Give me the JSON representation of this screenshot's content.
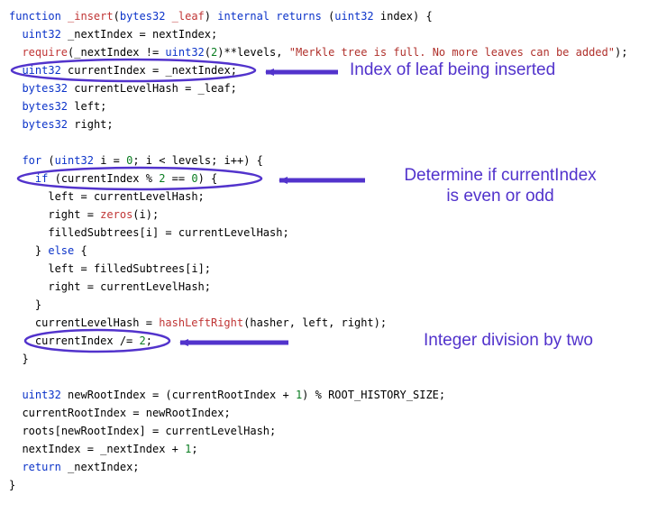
{
  "code": {
    "l1": {
      "a": "function",
      "b": "_insert",
      "c": "bytes32",
      "d": "_leaf",
      "e": "internal",
      "f": "returns",
      "g": "uint32",
      "h": "index"
    },
    "l2": {
      "a": "uint32",
      "b": "_nextIndex",
      "c": "nextIndex"
    },
    "l3": {
      "a": "require",
      "b": "_nextIndex",
      "c": "uint32",
      "d": "2",
      "e": "levels",
      "f": "\"Merkle tree is full. No more leaves can be added\""
    },
    "l4": {
      "a": "uint32",
      "b": "currentIndex",
      "c": "_nextIndex"
    },
    "l5": {
      "a": "bytes32",
      "b": "currentLevelHash",
      "c": "_leaf"
    },
    "l6": {
      "a": "bytes32",
      "b": "left"
    },
    "l7": {
      "a": "bytes32",
      "b": "right"
    },
    "l8": {
      "a": "for",
      "b": "uint32",
      "c": "i",
      "d": "0",
      "e": "i",
      "f": "levels",
      "g": "i"
    },
    "l9": {
      "a": "if",
      "b": "currentIndex",
      "c": "2",
      "d": "0"
    },
    "l10": {
      "a": "left",
      "b": "currentLevelHash"
    },
    "l11": {
      "a": "right",
      "b": "zeros",
      "c": "i"
    },
    "l12": {
      "a": "filledSubtrees",
      "b": "i",
      "c": "currentLevelHash"
    },
    "l13": {
      "a": "else"
    },
    "l14": {
      "a": "left",
      "b": "filledSubtrees",
      "c": "i"
    },
    "l15": {
      "a": "right",
      "b": "currentLevelHash"
    },
    "l16": {
      "a": "currentLevelHash",
      "b": "hashLeftRight",
      "c": "hasher",
      "d": "left",
      "e": "right"
    },
    "l17": {
      "a": "currentIndex",
      "b": "2"
    },
    "l18": {
      "a": "uint32",
      "b": "newRootIndex",
      "c": "currentRootIndex",
      "d": "1",
      "e": "ROOT_HISTORY_SIZE"
    },
    "l19": {
      "a": "currentRootIndex",
      "b": "newRootIndex"
    },
    "l20": {
      "a": "roots",
      "b": "newRootIndex",
      "c": "currentLevelHash"
    },
    "l21": {
      "a": "nextIndex",
      "b": "_nextIndex",
      "c": "1"
    },
    "l22": {
      "a": "return",
      "b": "_nextIndex"
    }
  },
  "annotations": {
    "a1": "Index of leaf being inserted",
    "a2_line1": "Determine if currentIndex",
    "a2_line2": "is even or odd",
    "a3": "Integer division by two"
  },
  "colors": {
    "annotation": "#5233cc"
  }
}
